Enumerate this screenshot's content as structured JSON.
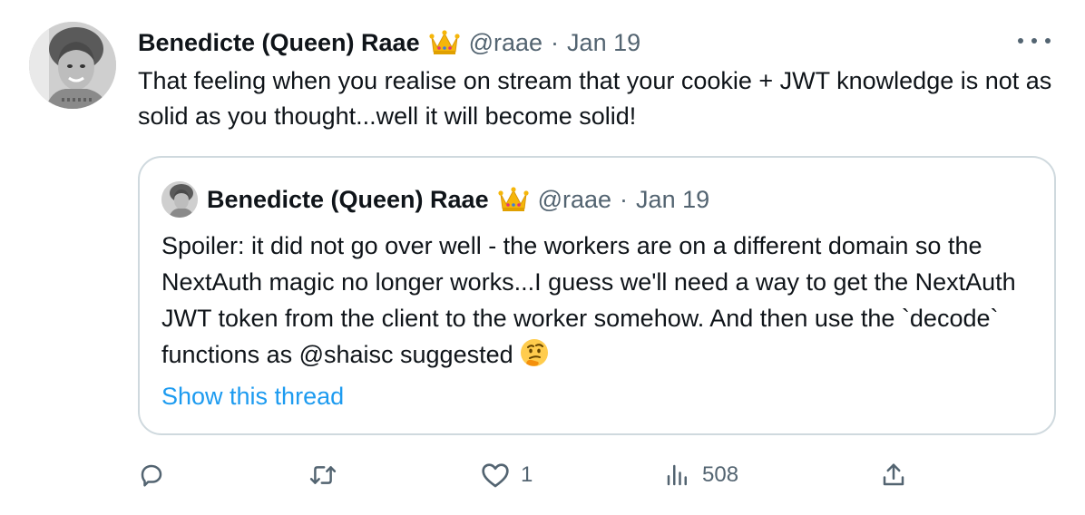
{
  "author": {
    "name": "Benedicte (Queen) Raae",
    "handle": "@raae",
    "date": "Jan 19",
    "separator": "·"
  },
  "tweet": {
    "text": "That feeling when you realise on stream that your cookie + JWT knowledge is not as solid as you thought...well it will become solid!"
  },
  "quoted": {
    "name": "Benedicte (Queen) Raae",
    "handle": "@raae",
    "date": "Jan 19",
    "separator": "·",
    "text": "Spoiler: it did not go over well - the workers are on a different domain so the NextAuth magic no longer works...I guess we'll need a way to get the NextAuth JWT token from the client to the worker somehow. And then use the `decode` functions as @shaisc suggested",
    "show_thread": "Show this thread"
  },
  "actions": {
    "reply_count": "",
    "retweet_count": "",
    "like_count": "1",
    "view_count": "508"
  },
  "colors": {
    "text": "#0f1419",
    "secondary": "#536471",
    "link": "#1d9bf0",
    "border": "#cfd9de"
  },
  "icons": [
    "more-icon",
    "crown-emoji",
    "thinking-emoji",
    "reply-icon",
    "retweet-icon",
    "like-icon",
    "views-icon",
    "share-icon"
  ]
}
